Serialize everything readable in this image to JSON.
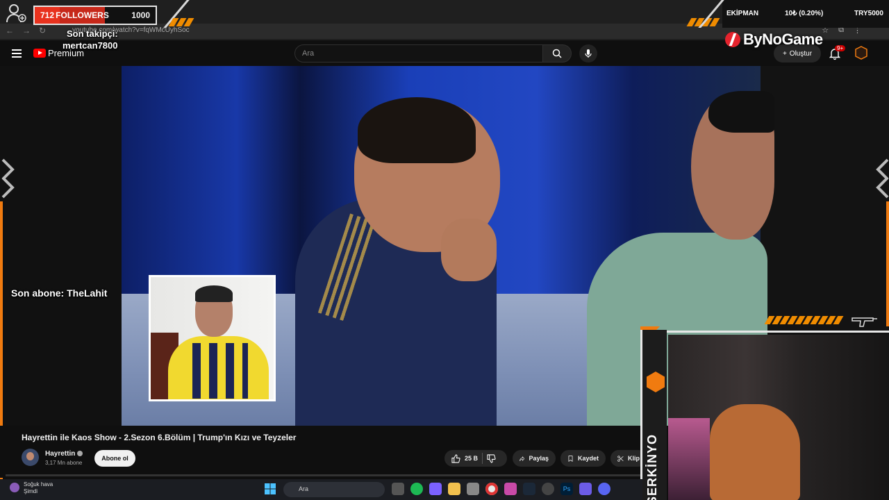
{
  "overlay": {
    "followers_count": "712",
    "followers_label": "FOLLOWERS",
    "followers_goal": "1000",
    "followers_progress": 0.712,
    "last_follower_label": "Son takipçi:",
    "last_follower_name": "mertcan7800",
    "last_sub_text": "Son abone: TheLahit",
    "equipment_label": "EKİPMAN",
    "stat_text": "10₺ (0.20%)",
    "price_text": "TRY5000",
    "brand": "ByNoGame",
    "streamer_name": "SERKİNYO",
    "accent": "#f07b10"
  },
  "browser": {
    "url": "youtube.com/watch?v=fqWMcUyhSoc"
  },
  "header": {
    "logo_text": "Premium",
    "search_placeholder": "Ara",
    "create_label": "Oluştur",
    "notif_badge": "9+"
  },
  "video": {
    "title": "Hayrettin ile Kaos Show - 2.Sezon 6.Bölüm | Trump'ın Kızı ve Teyzeler",
    "channel_name": "Hayrettin",
    "subscribers": "3,17 Mn abone",
    "subscribe_label": "Abone ol",
    "likes": "25 B",
    "share_label": "Paylaş",
    "save_label": "Kaydet",
    "clip_label": "Klip"
  },
  "taskbar": {
    "weather_title": "Soğuk hava",
    "weather_sub": "Şimdi",
    "search_label": "Ara"
  }
}
